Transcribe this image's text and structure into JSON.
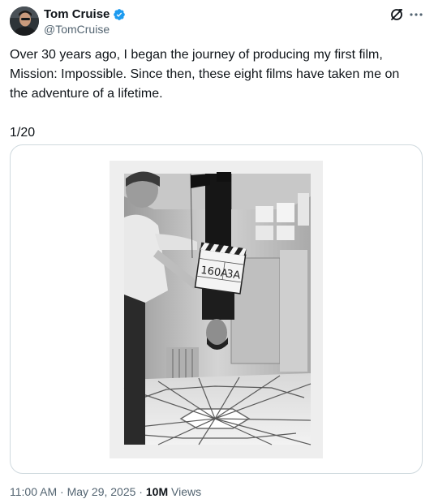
{
  "author": {
    "display_name": "Tom Cruise",
    "handle": "@TomCruise",
    "verified": true,
    "verified_color": "#1d9bf0"
  },
  "header_icons": {
    "grok": "grok-icon",
    "more": "more-icon"
  },
  "tweet": {
    "text": "Over 30 years ago, I began the journey of producing my first film, Mission: Impossible. Since then, these eight films have taken me on the adventure of a lifetime.",
    "thread_counter": "1/20"
  },
  "media": {
    "clapper_line1": "160A",
    "clapper_line2": "3A"
  },
  "meta": {
    "time": "11:00 AM",
    "separator1": " · ",
    "date": "May 29, 2025",
    "separator2": " · ",
    "views_count": "10M",
    "views_label": " Views"
  },
  "colors": {
    "text_primary": "#0f1419",
    "text_secondary": "#536471",
    "border": "#cfd9de"
  }
}
